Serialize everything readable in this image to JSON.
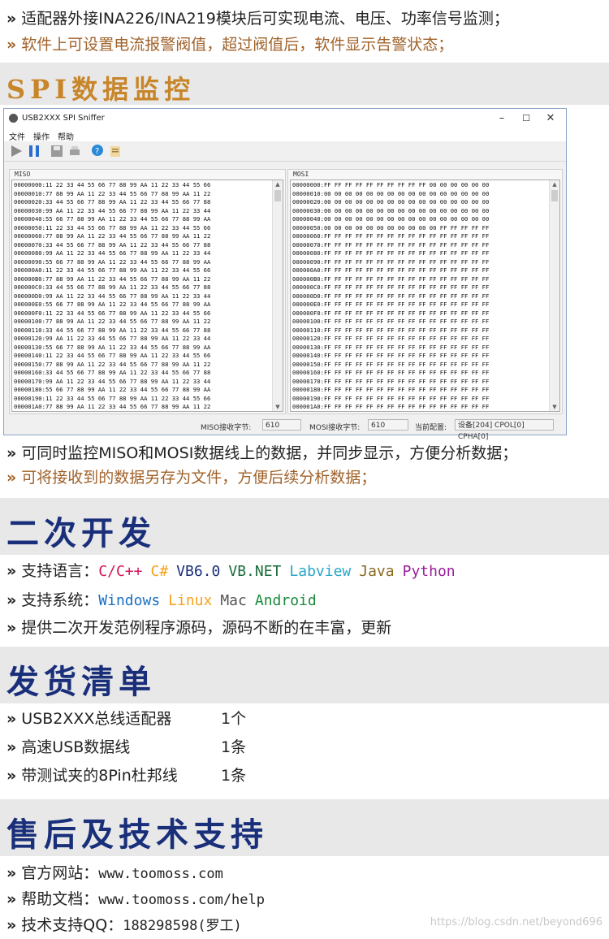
{
  "top_lines": [
    "适配器外接INA226/INA219模块后可实现电流、电压、功率信号监测；",
    "软件上可设置电流报警阀值，超过阀值后，软件显示告警状态；"
  ],
  "chevron": "»",
  "sections": {
    "spi": "SPI数据监控",
    "dev": "二次开发",
    "ship": "发货清单",
    "support": "售后及技术支持"
  },
  "app": {
    "title": "USB2XXX SPI Sniffer",
    "menu": [
      "文件",
      "操作",
      "帮助"
    ],
    "window_buttons": [
      "–",
      "☐",
      "✕"
    ],
    "miso_label": "MISO",
    "mosi_label": "MOSI",
    "miso_rows": [
      "00000000:11 22 33 44 55 66 77 88 99 AA 11 22 33 44 55 66",
      "00000010:77 88 99 AA 11 22 33 44 55 66 77 88 99 AA 11 22",
      "00000020:33 44 55 66 77 88 99 AA 11 22 33 44 55 66 77 88",
      "00000030:99 AA 11 22 33 44 55 66 77 88 99 AA 11 22 33 44",
      "00000040:55 66 77 88 99 AA 11 22 33 44 55 66 77 88 99 AA",
      "00000050:11 22 33 44 55 66 77 88 99 AA 11 22 33 44 55 66",
      "00000060:77 88 99 AA 11 22 33 44 55 66 77 88 99 AA 11 22",
      "00000070:33 44 55 66 77 88 99 AA 11 22 33 44 55 66 77 88",
      "00000080:99 AA 11 22 33 44 55 66 77 88 99 AA 11 22 33 44",
      "00000090:55 66 77 88 99 AA 11 22 33 44 55 66 77 88 99 AA",
      "000000A0:11 22 33 44 55 66 77 88 99 AA 11 22 33 44 55 66",
      "000000B0:77 88 99 AA 11 22 33 44 55 66 77 88 99 AA 11 22",
      "000000C0:33 44 55 66 77 88 99 AA 11 22 33 44 55 66 77 88",
      "000000D0:99 AA 11 22 33 44 55 66 77 88 99 AA 11 22 33 44",
      "000000E0:55 66 77 88 99 AA 11 22 33 44 55 66 77 88 99 AA",
      "000000F0:11 22 33 44 55 66 77 88 99 AA 11 22 33 44 55 66",
      "00000100:77 88 99 AA 11 22 33 44 55 66 77 88 99 AA 11 22",
      "00000110:33 44 55 66 77 88 99 AA 11 22 33 44 55 66 77 88",
      "00000120:99 AA 11 22 33 44 55 66 77 88 99 AA 11 22 33 44",
      "00000130:55 66 77 88 99 AA 11 22 33 44 55 66 77 88 99 AA",
      "00000140:11 22 33 44 55 66 77 88 99 AA 11 22 33 44 55 66",
      "00000150:77 88 99 AA 11 22 33 44 55 66 77 88 99 AA 11 22",
      "00000160:33 44 55 66 77 88 99 AA 11 22 33 44 55 66 77 88",
      "00000170:99 AA 11 22 33 44 55 66 77 88 99 AA 11 22 33 44",
      "00000180:55 66 77 88 99 AA 11 22 33 44 55 66 77 88 99 AA",
      "00000190:11 22 33 44 55 66 77 88 99 AA 11 22 33 44 55 66",
      "000001A0:77 88 99 AA 11 22 33 44 55 66 77 88 99 AA 11 22"
    ],
    "mosi_rows": [
      "00000000:FF FF FF FF FF FF FF FF FF FF 00 00 00 00 00 00",
      "00000010:00 00 00 00 00 00 00 00 00 00 00 00 00 00 00 00",
      "00000020:00 00 00 00 00 00 00 00 00 00 00 00 00 00 00 00",
      "00000030:00 00 00 00 00 00 00 00 00 00 00 00 00 00 00 00",
      "00000040:00 00 00 00 00 00 00 00 00 00 00 00 00 00 00 00",
      "00000050:00 00 00 00 00 00 00 00 00 00 00 FF FF FF FF FF",
      "00000060:FF FF FF FF FF FF FF FF FF FF FF FF FF FF FF FF",
      "00000070:FF FF FF FF FF FF FF FF FF FF FF FF FF FF FF FF",
      "00000080:FF FF FF FF FF FF FF FF FF FF FF FF FF FF FF FF",
      "00000090:FF FF FF FF FF FF FF FF FF FF FF FF FF FF FF FF",
      "000000A0:FF FF FF FF FF FF FF FF FF FF FF FF FF FF FF FF",
      "000000B0:FF FF FF FF FF FF FF FF FF FF FF FF FF FF FF FF",
      "000000C0:FF FF FF FF FF FF FF FF FF FF FF FF FF FF FF FF",
      "000000D0:FF FF FF FF FF FF FF FF FF FF FF FF FF FF FF FF",
      "000000E0:FF FF FF FF FF FF FF FF FF FF FF FF FF FF FF FF",
      "000000F0:FF FF FF FF FF FF FF FF FF FF FF FF FF FF FF FF",
      "00000100:FF FF FF FF FF FF FF FF FF FF FF FF FF FF FF FF",
      "00000110:FF FF FF FF FF FF FF FF FF FF FF FF FF FF FF FF",
      "00000120:FF FF FF FF FF FF FF FF FF FF FF FF FF FF FF FF",
      "00000130:FF FF FF FF FF FF FF FF FF FF FF FF FF FF FF FF",
      "00000140:FF FF FF FF FF FF FF FF FF FF FF FF FF FF FF FF",
      "00000150:FF FF FF FF FF FF FF FF FF FF FF FF FF FF FF FF",
      "00000160:FF FF FF FF FF FF FF FF FF FF FF FF FF FF FF FF",
      "00000170:FF FF FF FF FF FF FF FF FF FF FF FF FF FF FF FF",
      "00000180:FF FF FF FF FF FF FF FF FF FF FF FF FF FF FF FF",
      "00000190:FF FF FF FF FF FF FF FF FF FF FF FF FF FF FF FF",
      "000001A0:FF FF FF FF FF FF FF FF FF FF FF FF FF FF FF FF"
    ],
    "status": {
      "miso_count_label": "MISO接收字节:",
      "miso_count": "610",
      "mosi_count_label": "MOSI接收字节:",
      "mosi_count": "610",
      "config_label": "当前配置:",
      "config_value": "设备[204] CPOL[0] CPHA[0]"
    }
  },
  "feature_lines": [
    "可同时监控MISO和MOSI数据线上的数据，并同步显示，方便分析数据；",
    "可将接收到的数据另存为文件，方便后续分析数据；"
  ],
  "dev": {
    "lang_label": "支持语言：",
    "languages": [
      {
        "name": "C/C++",
        "color": "#d4145a"
      },
      {
        "name": "C#",
        "color": "#f7a21b"
      },
      {
        "name": "VB6.0",
        "color": "#1a2f7a"
      },
      {
        "name": "VB.NET",
        "color": "#1a6b3a"
      },
      {
        "name": "Labview",
        "color": "#29a6c9"
      },
      {
        "name": "Java",
        "color": "#8a6a1e"
      },
      {
        "name": "Python",
        "color": "#9b1c9b"
      }
    ],
    "sys_label": "支持系统：",
    "systems": [
      {
        "name": "Windows",
        "color": "#1a6fc4"
      },
      {
        "name": "Linux",
        "color": "#f7a21b"
      },
      {
        "name": "Mac",
        "color": "#555555"
      },
      {
        "name": "Android",
        "color": "#1a8a3a"
      }
    ],
    "source_line": "提供二次开发范例程序源码，源码不断的在丰富，更新"
  },
  "ship": [
    {
      "item": "USB2XXX总线适配器",
      "qty": "1个"
    },
    {
      "item": "高速USB数据线",
      "qty": "1条"
    },
    {
      "item": "带测试夹的8Pin杜邦线",
      "qty": "1条"
    }
  ],
  "support": {
    "site_label": "官方网站：",
    "site": "www.toomoss.com",
    "doc_label": "帮助文档：",
    "doc": "www.toomoss.com/help",
    "qq_label": "技术支持QQ：",
    "qq": "188298598(罗工)"
  },
  "watermark": "https://blog.csdn.net/beyond696",
  "colors": {
    "section_title_blue": "#1a2f7a",
    "section_title_brown": "#c8862a",
    "banner_bg": "#e8e8e8"
  }
}
